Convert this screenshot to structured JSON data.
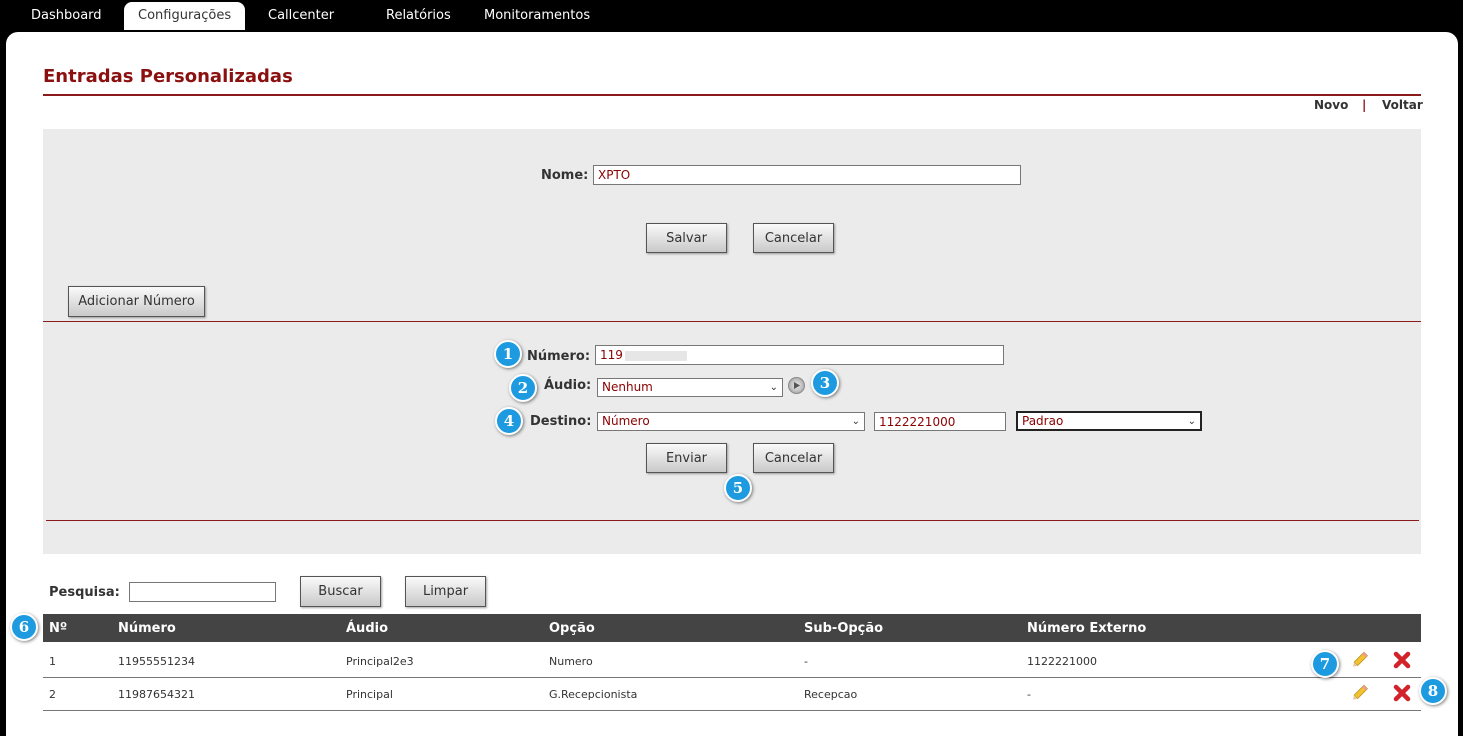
{
  "nav": {
    "tabs": [
      {
        "label": "Dashboard"
      },
      {
        "label": "Configurações"
      },
      {
        "label": "Callcenter"
      },
      {
        "label": "Relatórios"
      },
      {
        "label": "Monitoramentos"
      }
    ],
    "active": "Configurações"
  },
  "page": {
    "title": "Entradas Personalizadas",
    "actions": {
      "new": "Novo",
      "separator": "|",
      "back": "Voltar"
    }
  },
  "form": {
    "name_label": "Nome:",
    "name_value": "XPTO",
    "save": "Salvar",
    "cancel": "Cancelar",
    "add_number": "Adicionar Número"
  },
  "number_form": {
    "numero_label": "Número:",
    "numero_value": "119",
    "audio_label": "Áudio:",
    "audio_value": "Nenhum",
    "destino_label": "Destino:",
    "destino_type": "Número",
    "destino_number": "1122221000",
    "destino_option": "Padrao",
    "send": "Enviar",
    "cancel": "Cancelar"
  },
  "search": {
    "label": "Pesquisa:",
    "value": "",
    "search_button": "Buscar",
    "clear_button": "Limpar"
  },
  "table": {
    "headers": [
      "Nº",
      "Número",
      "Áudio",
      "Opção",
      "Sub-Opção",
      "Número Externo"
    ],
    "rows": [
      [
        "1",
        "11955551234",
        "Principal2e3",
        "Numero",
        "-",
        "1122221000"
      ],
      [
        "2",
        "11987654321",
        "Principal",
        "G.Recepcionista",
        "Recepcao",
        "-"
      ]
    ]
  },
  "callouts": [
    "1",
    "2",
    "3",
    "4",
    "5",
    "6",
    "7",
    "8"
  ],
  "colors": {
    "accent": "#8b1010",
    "callout": "#1e9be0",
    "table_header": "#444444",
    "panel": "#ebebeb"
  }
}
